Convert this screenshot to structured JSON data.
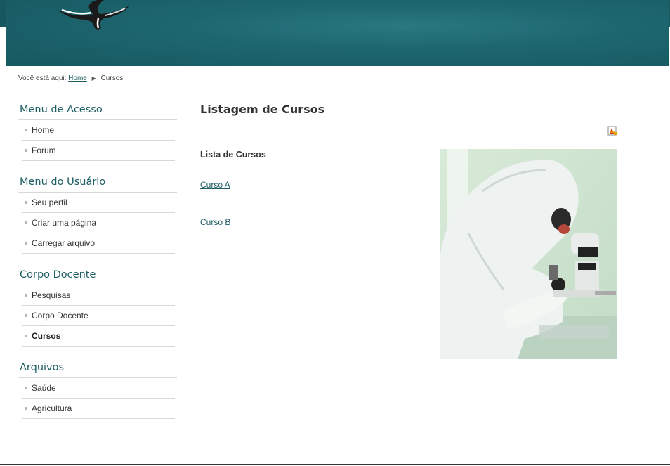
{
  "breadcrumb": {
    "prefix": "Você está aqui:",
    "home": "Home",
    "current": "Cursos"
  },
  "sidebar": {
    "menus": [
      {
        "title": "Menu de Acesso",
        "items": [
          "Home",
          "Forum"
        ]
      },
      {
        "title": "Menu do Usuário",
        "items": [
          "Seu perfil",
          "Criar uma página",
          "Carregar arquivo"
        ]
      },
      {
        "title": "Corpo Docente",
        "items": [
          "Pesquisas",
          "Corpo Docente",
          "Cursos"
        ],
        "active": "Cursos"
      },
      {
        "title": "Arquivos",
        "items": [
          "Saúde",
          "Agricultura"
        ]
      }
    ]
  },
  "content": {
    "title": "Listagem de Cursos",
    "list_title": "Lista de Cursos",
    "courses": [
      "Curso A",
      "Curso B"
    ]
  },
  "icons": {
    "pdf": "pdf-icon",
    "breadcrumb_separator": "triangle-right-icon"
  },
  "colors": {
    "accent": "#1d5d63",
    "banner": "#1d6670"
  }
}
